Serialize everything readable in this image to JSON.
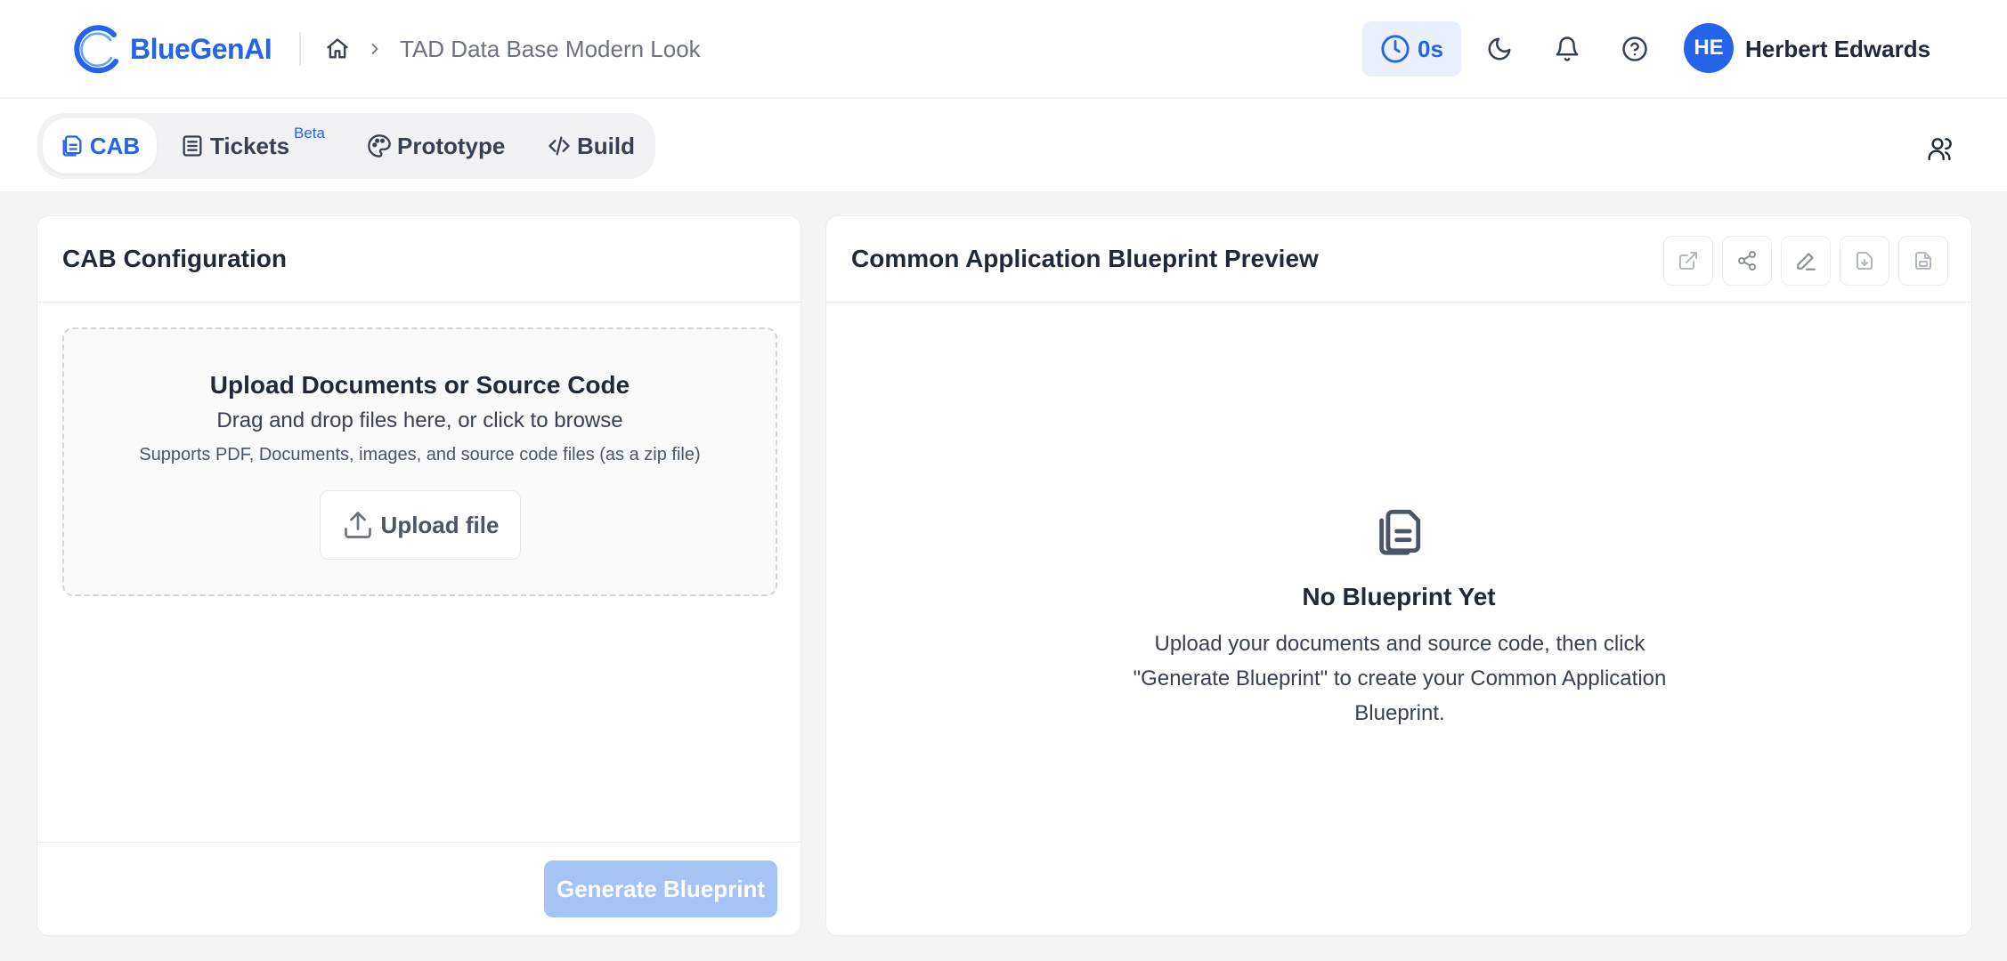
{
  "header": {
    "brand": "BlueGenAI",
    "breadcrumb": "TAD Data Base Modern Look",
    "timer": "0s",
    "user": {
      "initials": "HE",
      "name": "Herbert Edwards"
    }
  },
  "tabs": {
    "cab": "CAB",
    "tickets": "Tickets",
    "tickets_badge": "Beta",
    "prototype": "Prototype",
    "build": "Build"
  },
  "left_panel": {
    "title": "CAB Configuration",
    "dropzone": {
      "title": "Upload Documents or Source Code",
      "subtitle": "Drag and drop files here, or click to browse",
      "note": "Supports PDF, Documents, images, and source code files (as a zip file)",
      "upload_label": "Upload file"
    },
    "generate_label": "Generate Blueprint"
  },
  "right_panel": {
    "title": "Common Application Blueprint Preview",
    "empty_title": "No Blueprint Yet",
    "empty_desc": "Upload your documents and source code, then click \"Generate Blueprint\" to create your Common Application Blueprint."
  },
  "colors": {
    "accent": "#2563eb",
    "accent_light": "#eaf1fd",
    "disabled_button": "#a6c3f6",
    "page_bg": "#f4f4f5"
  },
  "icons": {
    "toolbar": [
      "open-external-icon",
      "share-icon",
      "edit-icon",
      "download-icon",
      "export-icon"
    ]
  }
}
